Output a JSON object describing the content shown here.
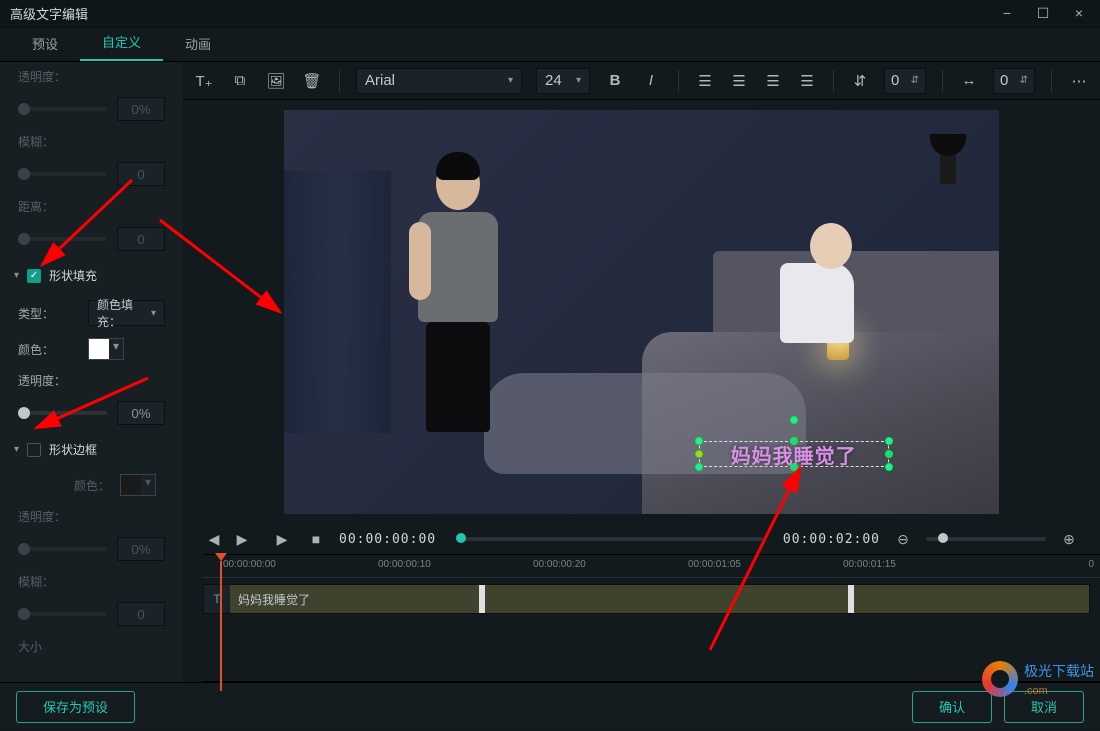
{
  "window": {
    "title": "高级文字编辑",
    "min": "−",
    "max": "☐",
    "close": "×"
  },
  "tabs": {
    "preset": "预设",
    "custom": "自定义",
    "anim": "动画"
  },
  "sidebar": {
    "opacity_label": "透明度：",
    "opacity_val": "0%",
    "blur_label": "模糊：",
    "blur_val": "0",
    "distance_label": "距离：",
    "distance_val": "0",
    "shape_fill_title": "形状填充",
    "type_label": "类型：",
    "type_value": "颜色填充：",
    "color_label": "颜色：",
    "fill_opacity_label": "透明度：",
    "fill_opacity_val": "0%",
    "shape_border_title": "形状边框",
    "border_color_label": "颜色：",
    "border_opacity_label": "透明度：",
    "border_opacity_val": "0%",
    "border_blur_label": "模糊：",
    "border_blur_val": "0",
    "size_label": "大小"
  },
  "toolbar": {
    "font_name": "Arial",
    "font_size": "24",
    "line_height": "0",
    "char_spacing": "0"
  },
  "preview": {
    "caption_text": "妈妈我睡觉了"
  },
  "playback": {
    "current_tc": "00:00:00:00",
    "end_tc": "00:00:02:00"
  },
  "ruler": {
    "ticks": [
      "00:00:00:00",
      "00:00:00:10",
      "00:00:00:20",
      "00:00:01:05",
      "00:00:01:15"
    ],
    "right": "0"
  },
  "timeline": {
    "clip_label": "妈妈我睡觉了"
  },
  "footer": {
    "save_preset": "保存为预设",
    "ok": "确认",
    "cancel": "取消"
  },
  "watermark": {
    "text": "极光下载站",
    "url": ".com"
  }
}
